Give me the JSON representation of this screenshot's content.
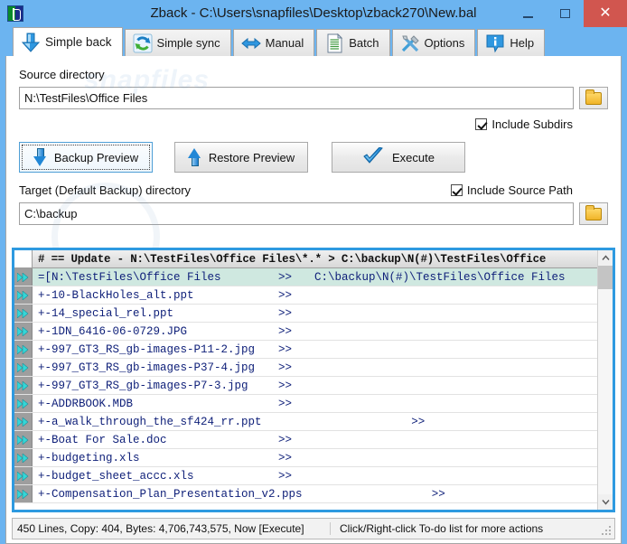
{
  "window": {
    "title": "Zback - C:\\Users\\snapfiles\\Desktop\\zback270\\New.bal",
    "app_icon": "zback-app-icon",
    "accent_color": "#6cb4f0",
    "close_color": "#d1564f",
    "minimize_label": "–",
    "maximize_label": "❐",
    "close_label": "✕"
  },
  "tabs": [
    {
      "label": "Simple back",
      "icon": "arrow-down-blue-icon",
      "active": true
    },
    {
      "label": "Simple sync",
      "icon": "sync-refresh-green-icon",
      "active": false
    },
    {
      "label": "Manual",
      "icon": "arrows-left-right-blue-icon",
      "active": false
    },
    {
      "label": "Batch",
      "icon": "document-list-icon",
      "active": false
    },
    {
      "label": "Options",
      "icon": "hammer-wrench-tools-icon",
      "active": false
    },
    {
      "label": "Help",
      "icon": "info-bubble-icon",
      "active": false
    }
  ],
  "form": {
    "source_label": "Source directory",
    "source_value": "N:\\TestFiles\\Office Files",
    "source_placeholder": "Source directory",
    "source_browse_icon": "folder-open-icon",
    "include_subdirs_label": "Include Subdirs",
    "include_subdirs_checked": true,
    "target_label": "Target (Default Backup) directory",
    "target_value": "C:\\backup",
    "target_placeholder": "Target directory",
    "target_browse_icon": "folder-open-icon",
    "include_source_path_label": "Include Source Path",
    "include_source_path_checked": true,
    "buttons": [
      {
        "label": "Backup Preview",
        "icon": "arrow-down-blue-icon",
        "focused": true
      },
      {
        "label": "Restore Preview",
        "icon": "arrow-up-blue-icon",
        "focused": false
      },
      {
        "label": "Execute",
        "icon": "blue-checkmark-icon",
        "focused": false
      }
    ]
  },
  "todo_list": {
    "header": "# == Update - N:\\TestFiles\\Office Files\\*.* > C:\\backup\\N(#)\\TestFiles\\Office",
    "row_icon": "fast-forward-icon",
    "rows": [
      {
        "name": "=[N:\\TestFiles\\Office Files",
        "arrow": ">>",
        "dest": "C:\\backup\\N(#)\\TestFiles\\Office Files",
        "highlight": true
      },
      {
        "name": "+-10-BlackHoles_alt.ppt",
        "arrow": ">>",
        "dest": "",
        "highlight": false
      },
      {
        "name": "+-14_special_rel.ppt",
        "arrow": ">>",
        "dest": "",
        "highlight": false
      },
      {
        "name": "+-1DN_6416-06-0729.JPG",
        "arrow": ">>",
        "dest": "",
        "highlight": false
      },
      {
        "name": "+-997_GT3_RS_gb-images-P11-2.jpg",
        "arrow": ">>",
        "dest": "",
        "highlight": false
      },
      {
        "name": "+-997_GT3_RS_gb-images-P37-4.jpg",
        "arrow": ">>",
        "dest": "",
        "highlight": false
      },
      {
        "name": "+-997_GT3_RS_gb-images-P7-3.jpg",
        "arrow": ">>",
        "dest": "",
        "highlight": false
      },
      {
        "name": "+-ADDRBOOK.MDB",
        "arrow": ">>",
        "dest": "",
        "highlight": false
      },
      {
        "name": "+-a_walk_through_the_sf424_rr.ppt",
        "arrow": ">>",
        "dest": "",
        "highlight": false
      },
      {
        "name": "+-Boat For Sale.doc",
        "arrow": ">>",
        "dest": "",
        "highlight": false
      },
      {
        "name": "+-budgeting.xls",
        "arrow": ">>",
        "dest": "",
        "highlight": false
      },
      {
        "name": "+-budget_sheet_accc.xls",
        "arrow": ">>",
        "dest": "",
        "highlight": false
      },
      {
        "name": "+-Compensation_Plan_Presentation_v2.pps",
        "arrow": ">>",
        "dest": "",
        "highlight": false
      }
    ],
    "scroll_up_icon": "chevron-up-icon",
    "scroll_down_icon": "chevron-down-icon"
  },
  "statusbar": {
    "left": "450  Lines, Copy: 404,  Bytes: 4,706,743,575, Now [Execute]",
    "right": "Click/Right-click To-do list for more actions",
    "grip_icon": "resize-grip-icon"
  }
}
